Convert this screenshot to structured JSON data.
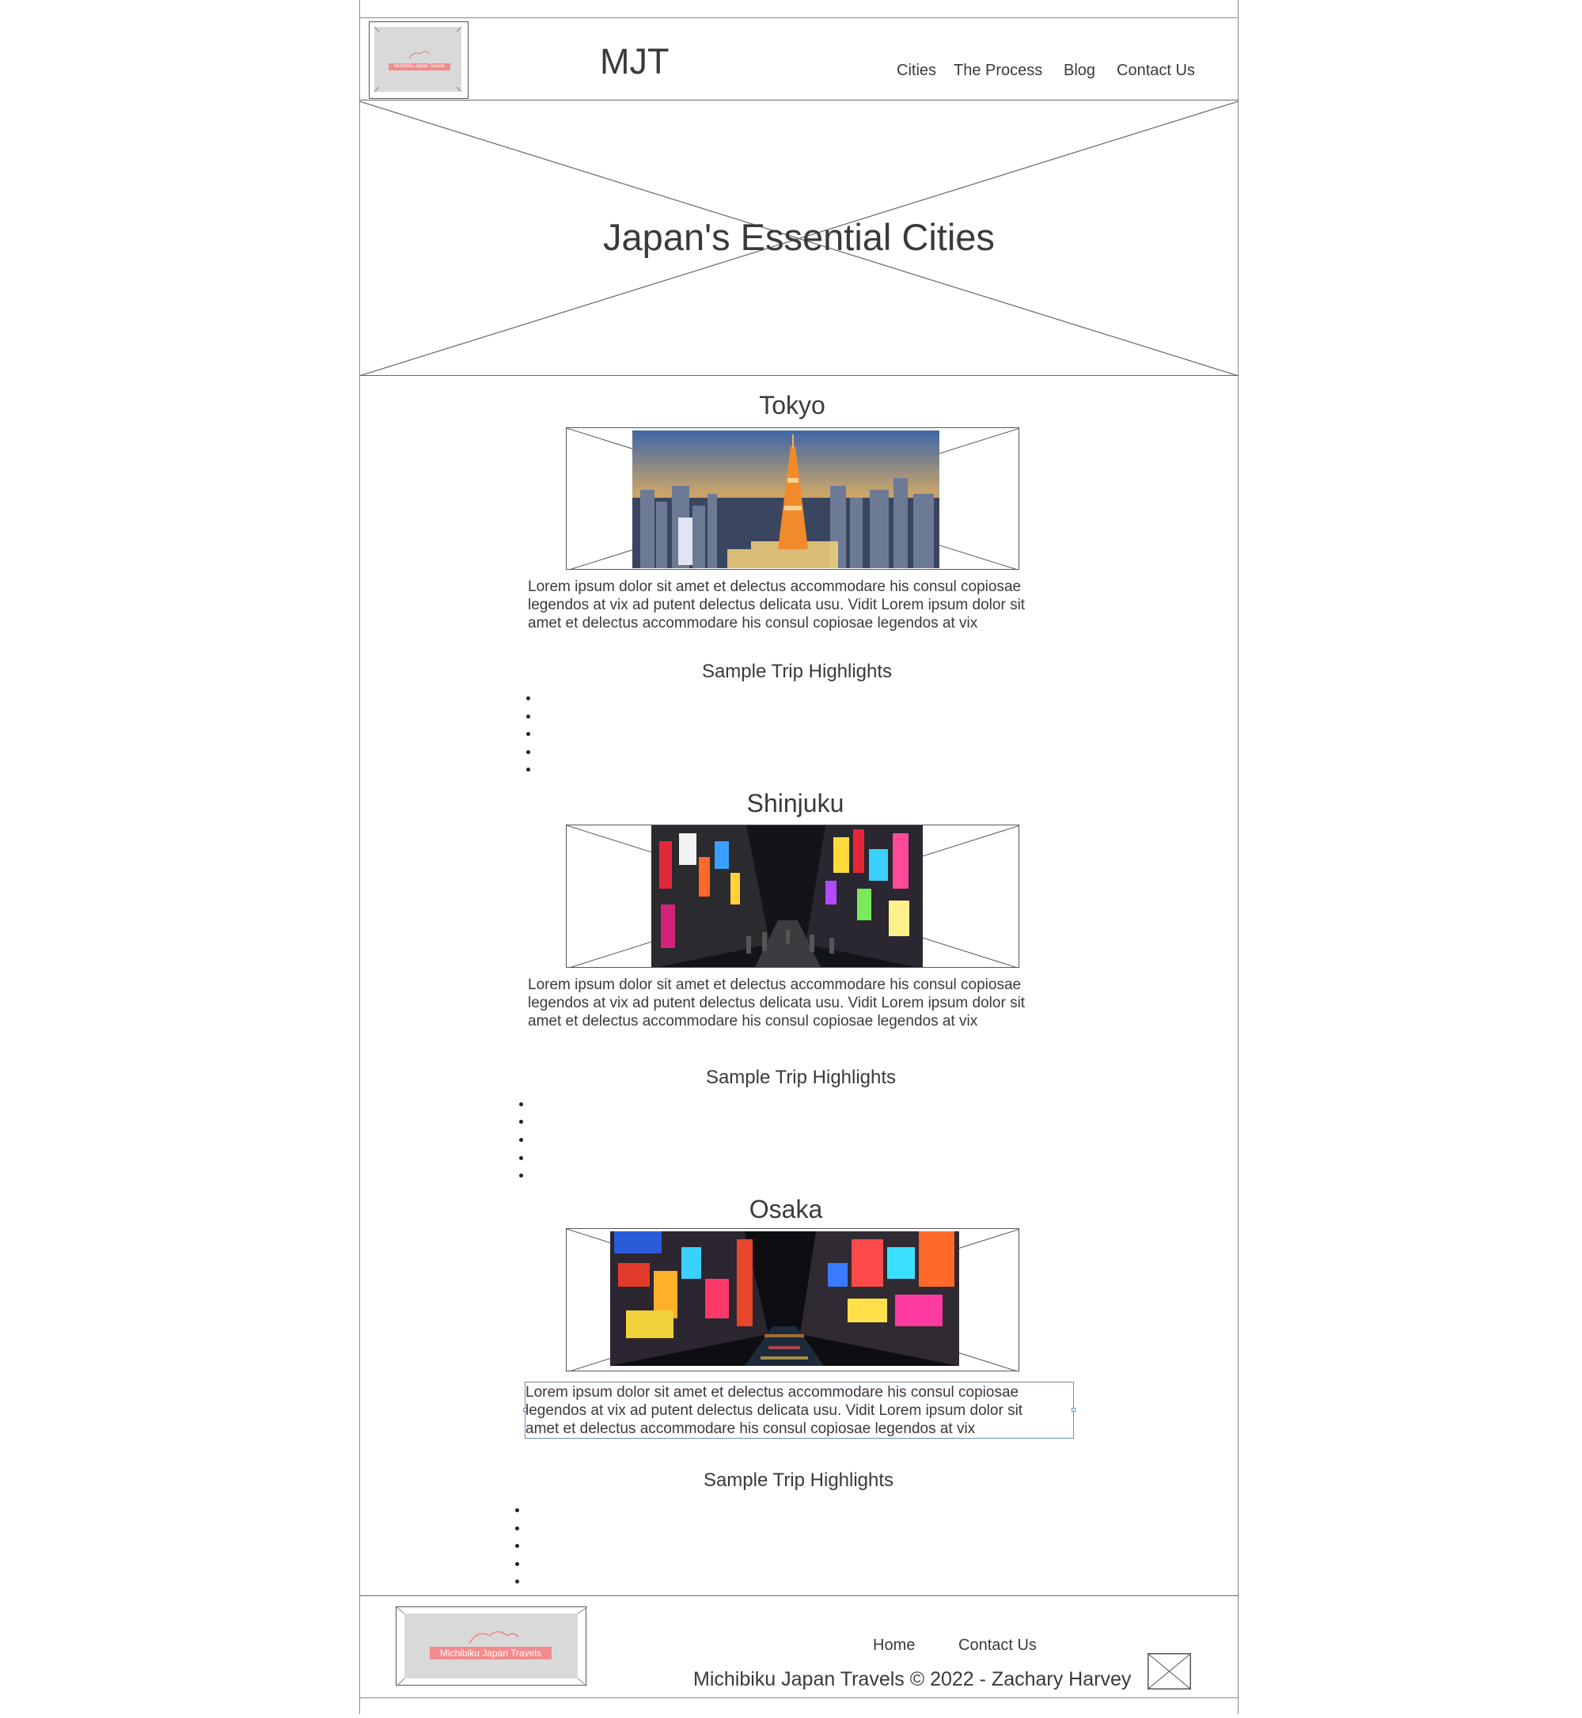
{
  "header": {
    "logo_text": "Michibiku Japan Travels",
    "site_title": "MJT",
    "nav": [
      "Cities",
      "The Process",
      "Blog",
      "Contact Us"
    ]
  },
  "hero": {
    "title": "Japan's Essential Cities"
  },
  "cities": [
    {
      "name": "Tokyo",
      "photo_icon": "tokyo-tower-skyline-photo",
      "description_lines": [
        "Lorem ipsum dolor sit amet et delectus accommodare his consul copiosae",
        "legendos at vix ad putent delectus delicata usu. Vidit Lorem ipsum dolor sit",
        "amet et delectus accommodare his consul copiosae legendos at vix"
      ],
      "highlights_title": "Sample Trip Highlights",
      "highlights_count": 5
    },
    {
      "name": "Shinjuku",
      "photo_icon": "shinjuku-night-street-photo",
      "description_lines": [
        "Lorem ipsum dolor sit amet et delectus accommodare his consul copiosae",
        "legendos at vix ad putent delectus delicata usu. Vidit Lorem ipsum dolor sit",
        "amet et delectus accommodare his consul copiosae legendos at vix"
      ],
      "highlights_title": "Sample Trip Highlights",
      "highlights_count": 5
    },
    {
      "name": "Osaka",
      "photo_icon": "osaka-dotonbori-canal-photo",
      "description_lines": [
        "Lorem ipsum dolor sit amet et delectus accommodare his consul copiosae",
        "legendos at vix ad putent delectus delicata usu. Vidit Lorem ipsum dolor sit",
        "amet et delectus accommodare his consul copiosae legendos at vix"
      ],
      "highlights_title": "Sample Trip Highlights",
      "highlights_count": 5
    }
  ],
  "footer": {
    "logo_text": "Michibiku Japan Travels",
    "links": [
      "Home",
      "Contact Us"
    ],
    "copyright": "Michibiku Japan Travels © 2022 - Zachary Harvey",
    "social_icon": "image-placeholder-icon"
  },
  "colors": {
    "accent": "#f28b8b",
    "text": "#3a3a3a",
    "outline": "#555555",
    "selection": "#6b8fb3"
  }
}
